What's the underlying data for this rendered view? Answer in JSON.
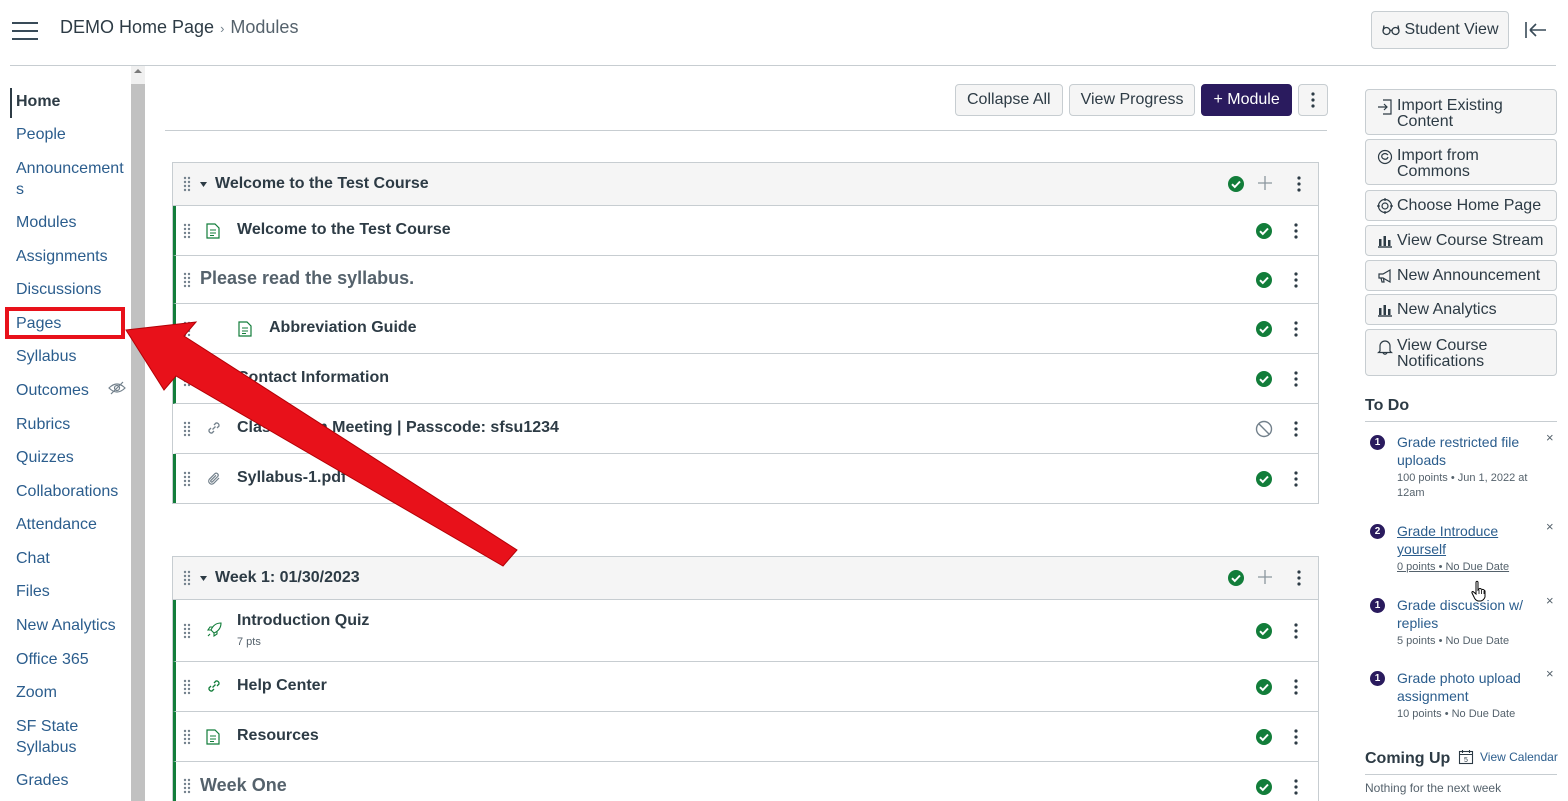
{
  "header": {
    "breadcrumb": [
      "DEMO Home Page",
      "Modules"
    ],
    "breadcrumb_separator": "›",
    "student_view_label": "Student View"
  },
  "nav": {
    "items": [
      {
        "label": "Home",
        "active": true
      },
      {
        "label": "People"
      },
      {
        "label": "Announcement\ns"
      },
      {
        "label": "Modules"
      },
      {
        "label": "Assignments"
      },
      {
        "label": "Discussions"
      },
      {
        "label": "Pages"
      },
      {
        "label": "Syllabus"
      },
      {
        "label": "Outcomes"
      },
      {
        "label": "Rubrics"
      },
      {
        "label": "Quizzes"
      },
      {
        "label": "Collaborations"
      },
      {
        "label": "Attendance"
      },
      {
        "label": "Chat"
      },
      {
        "label": "Files"
      },
      {
        "label": "New Analytics"
      },
      {
        "label": "Office 365"
      },
      {
        "label": "Zoom"
      },
      {
        "label": "SF State\nSyllabus"
      },
      {
        "label": "Grades"
      }
    ]
  },
  "toolbar": {
    "collapse_all": "Collapse All",
    "view_progress": "View Progress",
    "add_module": "+ Module"
  },
  "modules": [
    {
      "title": "Welcome to the Test Course",
      "items": [
        {
          "type": "page",
          "title": "Welcome to the Test Course",
          "status": "published"
        },
        {
          "type": "header",
          "title": "Please read the syllabus.",
          "status": "published"
        },
        {
          "type": "page",
          "title": "Abbreviation Guide",
          "status": "published",
          "indent": true
        },
        {
          "type": "page",
          "title": "Contact Information",
          "status": "published"
        },
        {
          "type": "link",
          "title": "Class Zoom Meeting | Passcode: sfsu1234",
          "status": "unpublished"
        },
        {
          "type": "file",
          "title": "Syllabus-1.pdf",
          "status": "published"
        }
      ]
    },
    {
      "title": "Week 1: 01/30/2023",
      "items": [
        {
          "type": "quiz",
          "title": "Introduction Quiz",
          "subtitle": "7 pts",
          "status": "published"
        },
        {
          "type": "link",
          "title": "Help Center",
          "status": "published"
        },
        {
          "type": "page",
          "title": "Resources",
          "status": "published"
        },
        {
          "type": "header",
          "title": "Week One",
          "status": "published"
        }
      ]
    }
  ],
  "sidebar": {
    "buttons": [
      {
        "label": "Import Existing\nContent",
        "icon": "import-icon"
      },
      {
        "label": "Import from\nCommons",
        "icon": "commons-icon"
      },
      {
        "label": "Choose Home Page",
        "icon": "target-icon"
      },
      {
        "label": "View Course Stream",
        "icon": "bar-chart-icon"
      },
      {
        "label": "New Announcement",
        "icon": "megaphone-icon"
      },
      {
        "label": "New Analytics",
        "icon": "bar-chart-icon"
      },
      {
        "label": "View Course\nNotifications",
        "icon": "bell-icon"
      }
    ],
    "todo_heading": "To Do",
    "todos": [
      {
        "count": "1",
        "title": "Grade restricted file uploads",
        "meta": "100 points • Jun 1, 2022 at 12am"
      },
      {
        "count": "2",
        "title": "Grade Introduce yourself",
        "meta": "0 points • No Due Date",
        "hover": true
      },
      {
        "count": "1",
        "title": "Grade discussion w/ replies",
        "meta": "5 points • No Due Date"
      },
      {
        "count": "1",
        "title": "Grade photo upload assignment",
        "meta": "10 points • No Due Date"
      }
    ],
    "coming_up_heading": "Coming Up",
    "view_calendar": "View Calendar",
    "calendar_day": "5",
    "nothing": "Nothing for the next week",
    "dismiss_symbol": "×"
  },
  "colors": {
    "brand": "#2a1b5e",
    "published": "#127d3a",
    "link": "#2b5d8d",
    "annotation": "#e8111a"
  }
}
